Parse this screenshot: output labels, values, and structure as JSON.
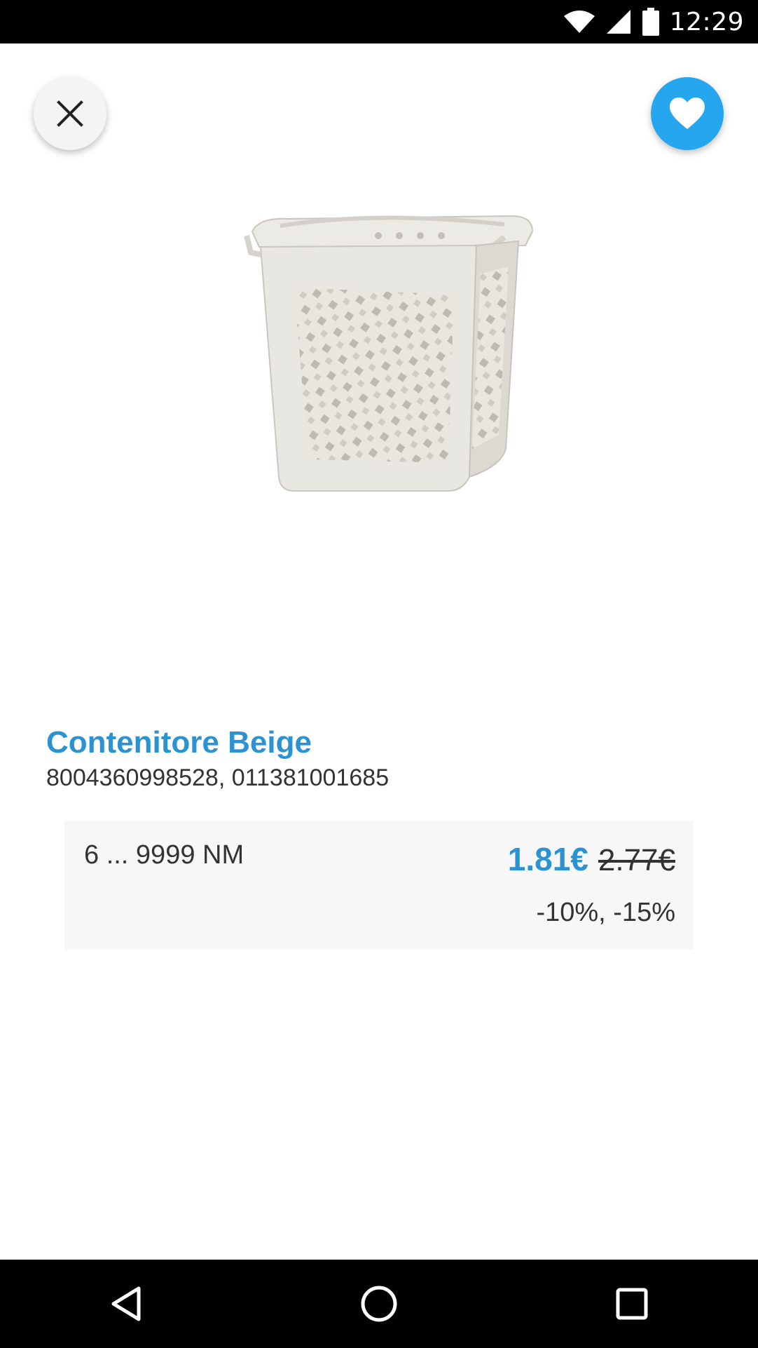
{
  "status_bar": {
    "time": "12:29",
    "icons": [
      "wifi-icon",
      "signal-icon",
      "battery-icon"
    ]
  },
  "header": {
    "close_icon": "close-icon",
    "favorite_icon": "heart-icon",
    "favorite_color": "#26a6ee"
  },
  "product": {
    "title": "Contenitore Beige",
    "codes": "8004360998528, 011381001685",
    "image": "laundry-basket-image"
  },
  "pricing": {
    "quantity_range": "6 ... 9999 NM",
    "current_price": "1.81€",
    "old_price": "2.77€",
    "discounts": "-10%, -15%",
    "accent_color": "#2b93d1"
  },
  "nav_bar": {
    "icons": [
      "back-icon",
      "home-icon",
      "recents-icon"
    ]
  }
}
